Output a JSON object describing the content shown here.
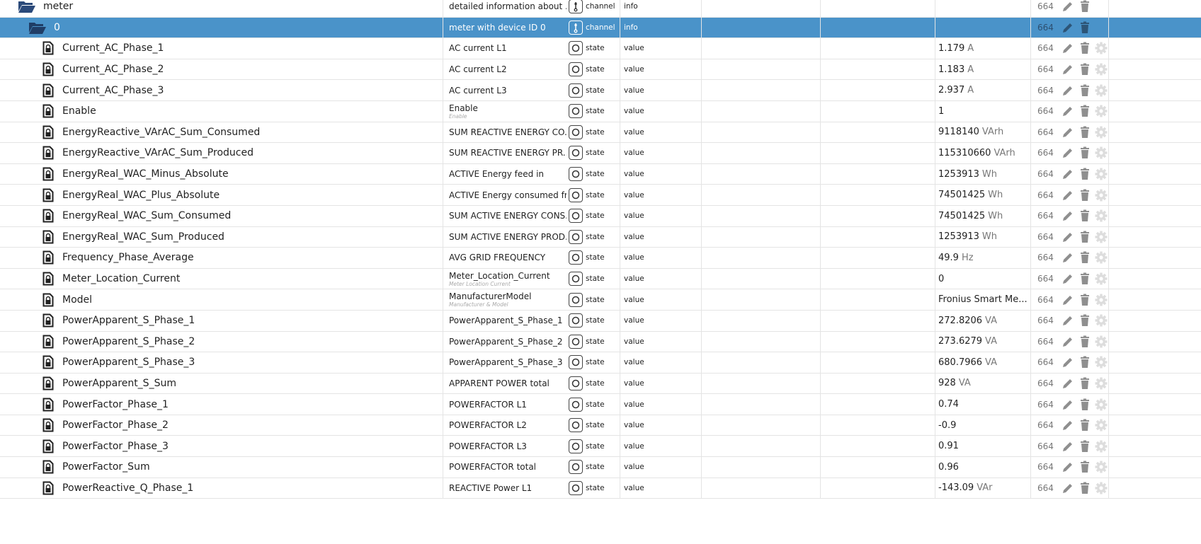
{
  "colors": {
    "selected_row": "#4a93c9",
    "folder": "#2b4a7a",
    "icon_gray": "#8f8f8f",
    "gear": "#dddddd"
  },
  "rows": [
    {
      "name": "meter",
      "indent": 1,
      "icon": "folder-open-icon",
      "desc": "detailed information about ...",
      "type": "channel",
      "role": "info",
      "value": "",
      "unit": "",
      "acl": "664",
      "gear": false,
      "selected": false
    },
    {
      "name": "0",
      "indent": 2,
      "icon": "folder-open-icon",
      "desc": "meter with device ID 0",
      "type": "channel",
      "role": "info",
      "value": "",
      "unit": "",
      "acl": "664",
      "gear": false,
      "selected": true
    },
    {
      "name": "Current_AC_Phase_1",
      "indent": 3,
      "icon": "locked-file-icon",
      "desc": "AC current L1",
      "type": "state",
      "role": "value",
      "value": "1.179",
      "unit": "A",
      "acl": "664",
      "gear": true
    },
    {
      "name": "Current_AC_Phase_2",
      "indent": 3,
      "icon": "locked-file-icon",
      "desc": "AC current L2",
      "type": "state",
      "role": "value",
      "value": "1.183",
      "unit": "A",
      "acl": "664",
      "gear": true
    },
    {
      "name": "Current_AC_Phase_3",
      "indent": 3,
      "icon": "locked-file-icon",
      "desc": "AC current L3",
      "type": "state",
      "role": "value",
      "value": "2.937",
      "unit": "A",
      "acl": "664",
      "gear": true
    },
    {
      "name": "Enable",
      "indent": 3,
      "icon": "locked-file-icon",
      "desc": "Enable",
      "desc_sub": "Enable",
      "type": "state",
      "role": "value",
      "value": "1",
      "unit": "",
      "acl": "664",
      "gear": true
    },
    {
      "name": "EnergyReactive_VArAC_Sum_Consumed",
      "indent": 3,
      "icon": "locked-file-icon",
      "desc": "SUM REACTIVE ENERGY CO...",
      "type": "state",
      "role": "value",
      "value": "9118140",
      "unit": "VArh",
      "acl": "664",
      "gear": true
    },
    {
      "name": "EnergyReactive_VArAC_Sum_Produced",
      "indent": 3,
      "icon": "locked-file-icon",
      "desc": "SUM REACTIVE ENERGY PR...",
      "type": "state",
      "role": "value",
      "value": "115310660",
      "unit": "VArh",
      "acl": "664",
      "gear": true
    },
    {
      "name": "EnergyReal_WAC_Minus_Absolute",
      "indent": 3,
      "icon": "locked-file-icon",
      "desc": "ACTIVE Energy feed in",
      "type": "state",
      "role": "value",
      "value": "1253913",
      "unit": "Wh",
      "acl": "664",
      "gear": true
    },
    {
      "name": "EnergyReal_WAC_Plus_Absolute",
      "indent": 3,
      "icon": "locked-file-icon",
      "desc": "ACTIVE Energy consumed fr...",
      "type": "state",
      "role": "value",
      "value": "74501425",
      "unit": "Wh",
      "acl": "664",
      "gear": true
    },
    {
      "name": "EnergyReal_WAC_Sum_Consumed",
      "indent": 3,
      "icon": "locked-file-icon",
      "desc": "SUM ACTIVE ENERGY CONS...",
      "type": "state",
      "role": "value",
      "value": "74501425",
      "unit": "Wh",
      "acl": "664",
      "gear": true
    },
    {
      "name": "EnergyReal_WAC_Sum_Produced",
      "indent": 3,
      "icon": "locked-file-icon",
      "desc": "SUM ACTIVE ENERGY PROD...",
      "type": "state",
      "role": "value",
      "value": "1253913",
      "unit": "Wh",
      "acl": "664",
      "gear": true
    },
    {
      "name": "Frequency_Phase_Average",
      "indent": 3,
      "icon": "file-icon",
      "desc": "AVG GRID FREQUENCY",
      "type": "state",
      "role": "value",
      "value": "49.9",
      "unit": "Hz",
      "acl": "664",
      "gear": true
    },
    {
      "name": "Meter_Location_Current",
      "indent": 3,
      "icon": "file-icon",
      "desc": "Meter_Location_Current",
      "desc_sub": "Meter Location Current",
      "type": "state",
      "role": "value",
      "value": "0",
      "unit": "",
      "acl": "664",
      "gear": true
    },
    {
      "name": "Model",
      "indent": 3,
      "icon": "file-icon",
      "desc": "ManufacturerModel",
      "desc_sub": "Manufacturer & Model",
      "type": "state",
      "role": "value",
      "value": "Fronius Smart Me...",
      "unit": "",
      "acl": "664",
      "gear": true
    },
    {
      "name": "PowerApparent_S_Phase_1",
      "indent": 3,
      "icon": "locked-file-icon",
      "desc": "PowerApparent_S_Phase_1",
      "type": "state",
      "role": "value",
      "value": "272.8206",
      "unit": "VA",
      "acl": "664",
      "gear": true
    },
    {
      "name": "PowerApparent_S_Phase_2",
      "indent": 3,
      "icon": "locked-file-icon",
      "desc": "PowerApparent_S_Phase_2",
      "type": "state",
      "role": "value",
      "value": "273.6279",
      "unit": "VA",
      "acl": "664",
      "gear": true
    },
    {
      "name": "PowerApparent_S_Phase_3",
      "indent": 3,
      "icon": "locked-file-icon",
      "desc": "PowerApparent_S_Phase_3",
      "type": "state",
      "role": "value",
      "value": "680.7966",
      "unit": "VA",
      "acl": "664",
      "gear": true
    },
    {
      "name": "PowerApparent_S_Sum",
      "indent": 3,
      "icon": "file-icon",
      "desc": "APPARENT POWER total",
      "type": "state",
      "role": "value",
      "value": "928",
      "unit": "VA",
      "acl": "664",
      "gear": true
    },
    {
      "name": "PowerFactor_Phase_1",
      "indent": 3,
      "icon": "locked-file-icon",
      "desc": "POWERFACTOR L1",
      "type": "state",
      "role": "value",
      "value": "0.74",
      "unit": "",
      "acl": "664",
      "gear": true
    },
    {
      "name": "PowerFactor_Phase_2",
      "indent": 3,
      "icon": "locked-file-icon",
      "desc": "POWERFACTOR L2",
      "type": "state",
      "role": "value",
      "value": "-0.9",
      "unit": "",
      "acl": "664",
      "gear": true
    },
    {
      "name": "PowerFactor_Phase_3",
      "indent": 3,
      "icon": "locked-file-icon",
      "desc": "POWERFACTOR L3",
      "type": "state",
      "role": "value",
      "value": "0.91",
      "unit": "",
      "acl": "664",
      "gear": true
    },
    {
      "name": "PowerFactor_Sum",
      "indent": 3,
      "icon": "file-icon",
      "desc": "POWERFACTOR total",
      "type": "state",
      "role": "value",
      "value": "0.96",
      "unit": "",
      "acl": "664",
      "gear": true
    },
    {
      "name": "PowerReactive_Q_Phase_1",
      "indent": 3,
      "icon": "locked-file-icon",
      "desc": "REACTIVE Power L1",
      "type": "state",
      "role": "value",
      "value": "-143.09",
      "unit": "VAr",
      "acl": "664",
      "gear": true
    }
  ]
}
